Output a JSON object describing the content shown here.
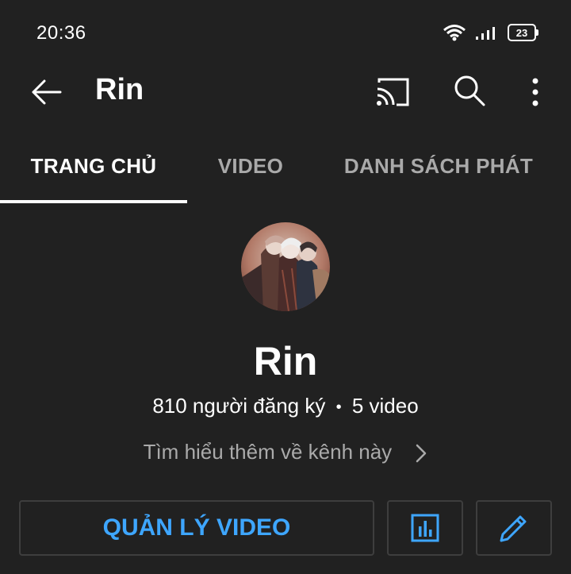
{
  "status_bar": {
    "time": "20:36",
    "battery": "23",
    "icons": [
      "wifi-icon",
      "signal-icon",
      "battery-icon"
    ]
  },
  "app_bar": {
    "title": "Rin",
    "icons": [
      "back-arrow-icon",
      "cast-icon",
      "search-icon",
      "more-vert-icon"
    ]
  },
  "tabs": [
    {
      "label": "TRANG CHỦ",
      "active": true
    },
    {
      "label": "VIDEO",
      "active": false
    },
    {
      "label": "DANH SÁCH PHÁT",
      "active": false
    }
  ],
  "channel": {
    "name": "Rin",
    "subscribers": "810 người đăng ký",
    "separator": "•",
    "videos": "5 video",
    "learn_more": "Tìm hiểu thêm về kênh này"
  },
  "actions": {
    "manage_videos": "QUẢN LÝ VIDEO",
    "analytics_icon": "analytics-icon",
    "edit_icon": "edit-pencil-icon"
  },
  "colors": {
    "background": "#212121",
    "accent": "#3ea6ff",
    "secondary_text": "#aaaaaa",
    "border": "#3e3e3e"
  }
}
